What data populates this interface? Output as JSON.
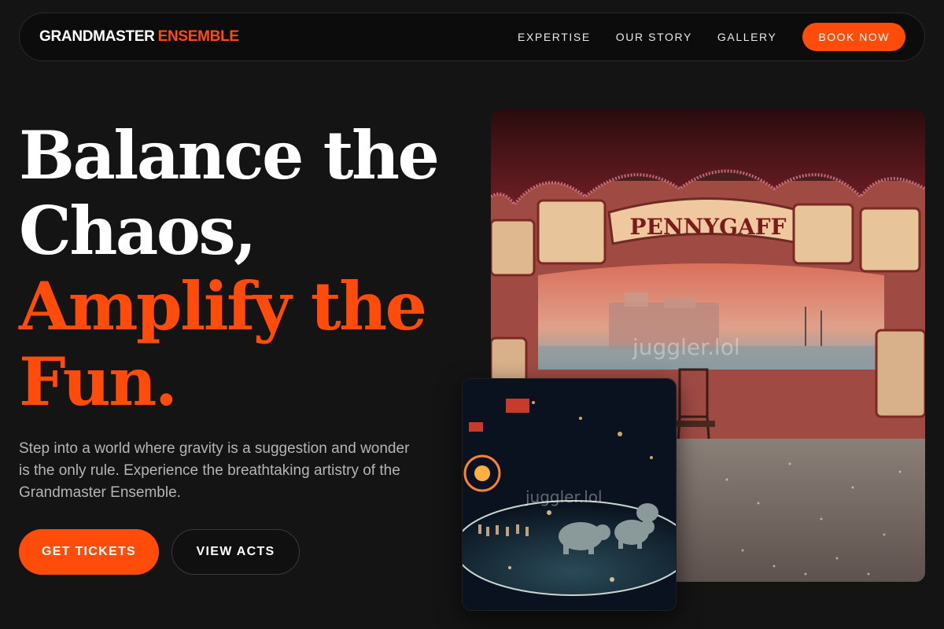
{
  "brand": {
    "part1": "GRANDMASTER",
    "part2": "ENSEMBLE"
  },
  "nav": {
    "links": [
      "EXPERTISE",
      "OUR STORY",
      "GALLERY"
    ],
    "cta": "BOOK NOW"
  },
  "hero": {
    "line1": "Balance the",
    "line2": "Chaos,",
    "line3": "Amplify the",
    "line4": "Fun.",
    "description": "Step into a world where gravity is a suggestion and wonder is the only rule. Experience the breathtaking artistry of the Grandmaster Ensemble.",
    "primary_button": "GET TICKETS",
    "secondary_button": "VIEW ACTS"
  },
  "images": {
    "main_watermark": "juggler.lol",
    "small_watermark": "juggler.lol",
    "banner_text": "PENNYGAFF"
  },
  "colors": {
    "accent": "#ff4c0a",
    "background": "#141414",
    "nav_background": "#0c0c0c"
  }
}
